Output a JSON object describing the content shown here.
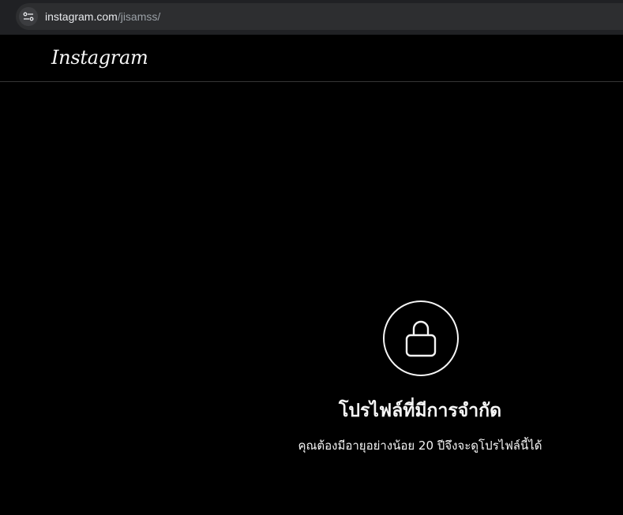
{
  "browser": {
    "url_domain": "instagram.com",
    "url_path": "/jisamss/",
    "site_info_icon": "tune-icon"
  },
  "header": {
    "logo_text": "Instagram"
  },
  "restricted": {
    "icon": "lock-icon",
    "title": "โปรไฟล์ที่มีการจำกัด",
    "message": "คุณต้องมีอายุอย่างน้อย 20 ปีจึงจะดูโปรไฟล์นี้ได้"
  },
  "colors": {
    "page_background": "#000000",
    "browser_bar": "#202124",
    "address_bar": "#2d2e30",
    "text_primary": "#f5f5f5",
    "url_path": "#9aa0a6",
    "divider": "#363636"
  }
}
